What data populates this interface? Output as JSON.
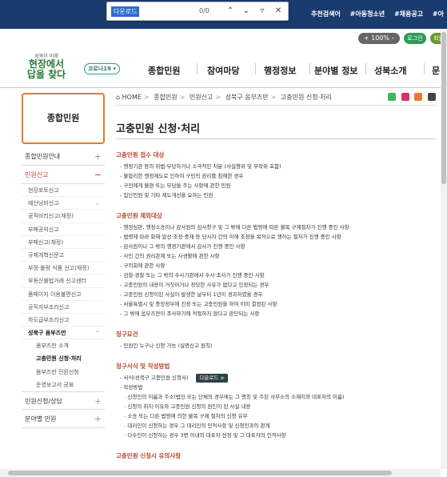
{
  "findbar": {
    "query": "다운로드",
    "count": "0/0"
  },
  "toplinks": [
    "추천검색어",
    "#아동청소년",
    "#채용공고",
    "#아"
  ],
  "tools": {
    "zoom": "+ 100% -",
    "login": "로그인",
    "join": "회원"
  },
  "logo": {
    "tagline": "성북이 미래",
    "main": "현장에서 답을 찾다"
  },
  "covid_label": "코로나19 ▾",
  "gnb": [
    "종합민원",
    "참여마당",
    "행정정보",
    "분야별 정보",
    "성북소개",
    "문"
  ],
  "breadcrumb": [
    "HOME",
    "종합민원",
    "민원신고",
    "성북구 옴부즈만",
    "고충민원 신청·처리"
  ],
  "side": {
    "title": "종합민원",
    "top1": "종합민원안내",
    "top2": "민원신고",
    "sub": [
      "현장포토신고",
      "예산낭비신고",
      "공직비리신고(재정)",
      "부패공익신고",
      "부패신고(재정)",
      "규제개혁신문고",
      "부정·불량 식품 신고(재정)",
      "부동산불법거래 신고센터",
      "품페이지 이용불편신고",
      "공직자부조리신고",
      "하도급부조리신고",
      "성북구 옴부즈만"
    ],
    "sub3": [
      "옴부즈만 소개",
      "고충민원 신청·처리",
      "옴부즈만 민원신청",
      "운영보고서 공표"
    ],
    "bottom": [
      "민원신청/상담",
      "분야별 민원"
    ]
  },
  "page_title": "고충민원 신청·처리",
  "sections": [
    {
      "title": "고충민원 접수 대상",
      "items": [
        "행정기관 등의 위법·부당하거나 소극적인 처분 (사실행위 및 부작위 포함)",
        "불합리한 행정제도로 인하여 구민의 권리를 침해한 경우",
        "구민에게 불편 또는 부담을 주는 사항에 관한 민원",
        "집단민원 및 기타 제도개선을 요하는 민원"
      ]
    },
    {
      "title": "고충민원 제외대상",
      "items": [
        "행정심판, 행정소송이나 감사원의 심사청구 및 그 밖에 다른 법령에 따른 불복 구제절차가 진행 중인 사항",
        "법령에 따라 화해·알선·조정·중재 등 당사자 간의 이해 조정을 목적으로 행하는 절차가 진행 중인 사항",
        "감사원이나 그 밖의 행정기관에서 감사가 진행 중인 사항",
        "사인 간의 권리관계 또는 사생활에 관한 사항",
        "구의회에 관한 사항",
        "검찰·경찰 또는 그 밖의 수사기관에서 수사·조사가 진행 중인 사항",
        "고충민원의 내용이 거짓이거나 정당한 사유가 없다고 인정되는 경우",
        "고충민원 신청이된 사실이 발생한 날부터 1년이 경과하였을 경우",
        "서울특별시 및 중앙정부에 진정 또는 고충민원을 하여 이미 결정된 사항",
        "그 밖에 옴부즈만이 조사하기에 적절하지 않다고 판단되는 사항"
      ]
    },
    {
      "title": "청구요건",
      "items": [
        "민원인 누구나 신청 가능 (실명신고 원칙)"
      ]
    },
    {
      "title": "청구서식 및 작성방법",
      "form_item": "서식(성북구 고충민원 신청서)",
      "download": "다운로드",
      "method": "작성방법",
      "subs": [
        "신청인의 이름과 주소(법인 또는 단체의 경우에는 그 명칭 및 주된 사무소의 소재지와 대표자의 이름)",
        "신청의 취지·이유와 고충민원 신청의 원인이 된 사실 내용",
        "소송 또는 다른 법령에 의한 불복 구제 절차의 신청 유무",
        "대리인이 신청하는 경우 그 대리인의 인적사항 및 신청인과의 관계",
        "다수인이 신청하는 경우 3명 이내의 대표자 선정 및 그 대표자의 인적사항"
      ]
    },
    {
      "title": "고충민원 신청시 유의사항",
      "items": []
    }
  ]
}
